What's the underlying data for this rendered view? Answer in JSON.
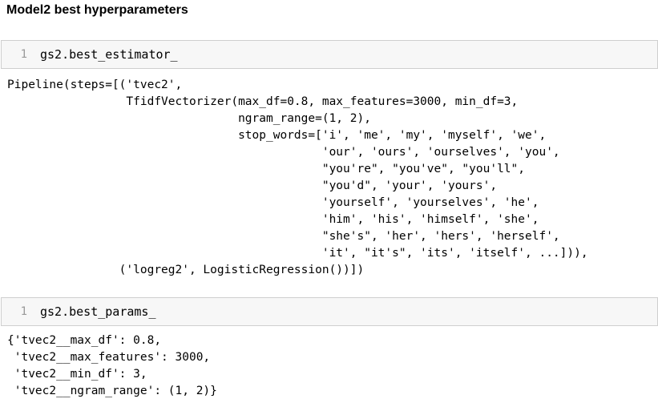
{
  "heading": "Model2 best hyperparameters",
  "cells": [
    {
      "line_number": "1",
      "input": "gs2.best_estimator_",
      "output": "Pipeline(steps=[('tvec2',\n                 TfidfVectorizer(max_df=0.8, max_features=3000, min_df=3,\n                                 ngram_range=(1, 2),\n                                 stop_words=['i', 'me', 'my', 'myself', 'we',\n                                             'our', 'ours', 'ourselves', 'you',\n                                             \"you're\", \"you've\", \"you'll\",\n                                             \"you'd\", 'your', 'yours',\n                                             'yourself', 'yourselves', 'he',\n                                             'him', 'his', 'himself', 'she',\n                                             \"she's\", 'her', 'hers', 'herself',\n                                             'it', \"it's\", 'its', 'itself', ...])),\n                ('logreg2', LogisticRegression())])"
    },
    {
      "line_number": "1",
      "input": "gs2.best_params_",
      "output": "{'tvec2__max_df': 0.8,\n 'tvec2__max_features': 3000,\n 'tvec2__min_df': 3,\n 'tvec2__ngram_range': (1, 2)}"
    }
  ]
}
